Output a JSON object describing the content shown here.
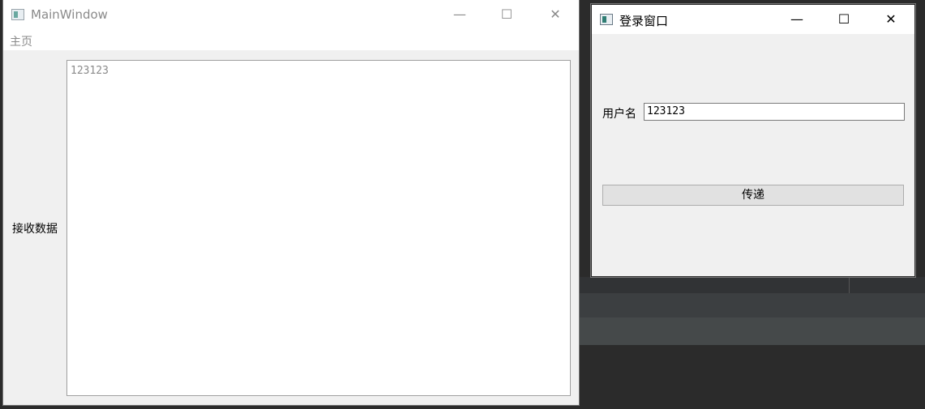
{
  "main_window": {
    "title": "MainWindow",
    "icon": "app-window-icon",
    "controls": {
      "minimize": "—",
      "maximize": "☐",
      "close": "✕"
    },
    "menu": [
      "主页"
    ],
    "receive_label": "接收数据",
    "received_text": "123123"
  },
  "login_window": {
    "title": "登录窗口",
    "icon": "app-window-icon",
    "controls": {
      "minimize": "—",
      "maximize": "☐",
      "close": "✕"
    },
    "username_label": "用户名",
    "username_value": "123123",
    "send_button_label": "传递"
  }
}
